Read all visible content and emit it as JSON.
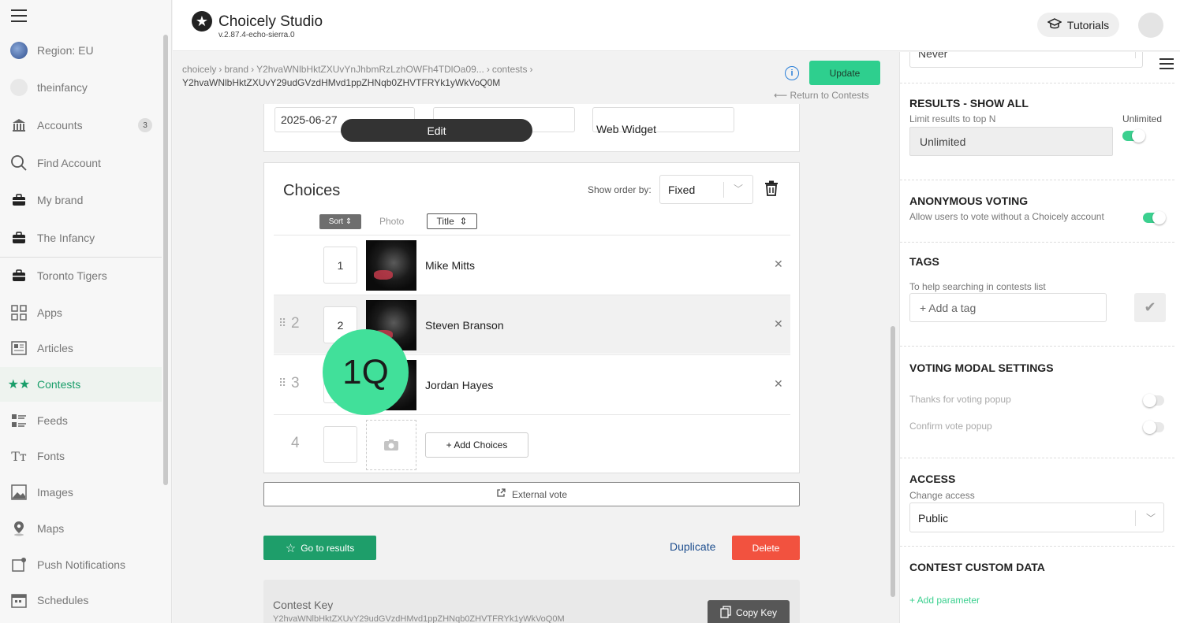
{
  "sidebar": {
    "items": [
      {
        "label": "Region: EU",
        "icon": "globe-icon"
      },
      {
        "label": "theinfancy",
        "icon": "avatar-icon"
      },
      {
        "label": "Accounts",
        "icon": "bank-icon",
        "badge": "3"
      },
      {
        "label": "Find Account",
        "icon": "search-icon"
      },
      {
        "label": "My brand",
        "icon": "briefcase-icon"
      },
      {
        "label": "The Infancy",
        "icon": "briefcase-icon"
      },
      {
        "label": "Toronto Tigers",
        "icon": "briefcase-icon"
      },
      {
        "label": "Apps",
        "icon": "apps-grid-icon"
      },
      {
        "label": "Articles",
        "icon": "article-icon"
      },
      {
        "label": "Contests",
        "icon": "stars-icon",
        "active": true
      },
      {
        "label": "Feeds",
        "icon": "feed-icon"
      },
      {
        "label": "Fonts",
        "icon": "font-icon"
      },
      {
        "label": "Images",
        "icon": "image-icon"
      },
      {
        "label": "Maps",
        "icon": "map-pin-icon"
      },
      {
        "label": "Push Notifications",
        "icon": "notification-icon"
      },
      {
        "label": "Schedules",
        "icon": "calendar-icon"
      }
    ]
  },
  "header": {
    "title": "Choicely Studio",
    "version": "v.2.87.4-echo-sierra.0",
    "tutorials_label": "Tutorials"
  },
  "breadcrumb": {
    "parts": [
      "choicely",
      "brand",
      "Y2hvaWNlbHktZXUvYnJhbmRzLzhOWFh4TDlOa09...",
      "contests"
    ],
    "line2": "Y2hvaWNlbHktZXUvY29udGVzdHMvd1ppZHNqb0ZHVTFRYk1yWkVoQ0M"
  },
  "actions": {
    "update_label": "Update",
    "return_label": "Return to Contests"
  },
  "contest_top": {
    "date_value": "2025-06-27",
    "edit_label": "Edit",
    "web_widget_label": "Web Widget"
  },
  "choices": {
    "title": "Choices",
    "show_order_label": "Show order by:",
    "show_order_value": "Fixed",
    "headers": {
      "sort": "Sort",
      "photo": "Photo",
      "title": "Title"
    },
    "rows": [
      {
        "num": "1",
        "pos": "1",
        "name": "Mike Mitts"
      },
      {
        "num": "2",
        "pos": "2",
        "name": "Steven Branson"
      },
      {
        "num": "3",
        "pos": "3",
        "name": "Jordan Hayes"
      }
    ],
    "add_row_num": "4",
    "add_choices_label": "+ Add Choices"
  },
  "overlay_badge": "1Q",
  "footer": {
    "external_vote_label": "External vote",
    "go_to_results_label": "Go to results",
    "duplicate_label": "Duplicate",
    "delete_label": "Delete",
    "contest_key_label": "Contest Key",
    "contest_key_value": "Y2hvaWNlbHktZXUvY29udGVzdHMvd1ppZHNqb0ZHVTFRYk1yWkVoQ0M",
    "copy_key_label": "Copy Key"
  },
  "right_panel": {
    "never_value": "Never",
    "results": {
      "title": "RESULTS - SHOW ALL",
      "subtitle": "Limit results to top N",
      "unlimited_label": "Unlimited",
      "input_value": "Unlimited"
    },
    "anonymous": {
      "title": "ANONYMOUS VOTING",
      "subtitle": "Allow users to vote without a Choicely account"
    },
    "tags": {
      "title": "TAGS",
      "subtitle": "To help searching in contests list",
      "placeholder": "+ Add a tag"
    },
    "voting_modal": {
      "title": "VOTING MODAL SETTINGS",
      "thanks_label": "Thanks for voting popup",
      "confirm_label": "Confirm vote popup"
    },
    "access": {
      "title": "ACCESS",
      "subtitle": "Change access",
      "value": "Public"
    },
    "custom_data": {
      "title": "CONTEST CUSTOM DATA",
      "add_param_label": "+ Add parameter"
    }
  },
  "colors": {
    "accent_green": "#1e9e6a",
    "update_green": "#2ecf8e",
    "delete_red": "#f2523f",
    "badge_green": "#41e09a",
    "link_blue": "#1f4f8f"
  }
}
